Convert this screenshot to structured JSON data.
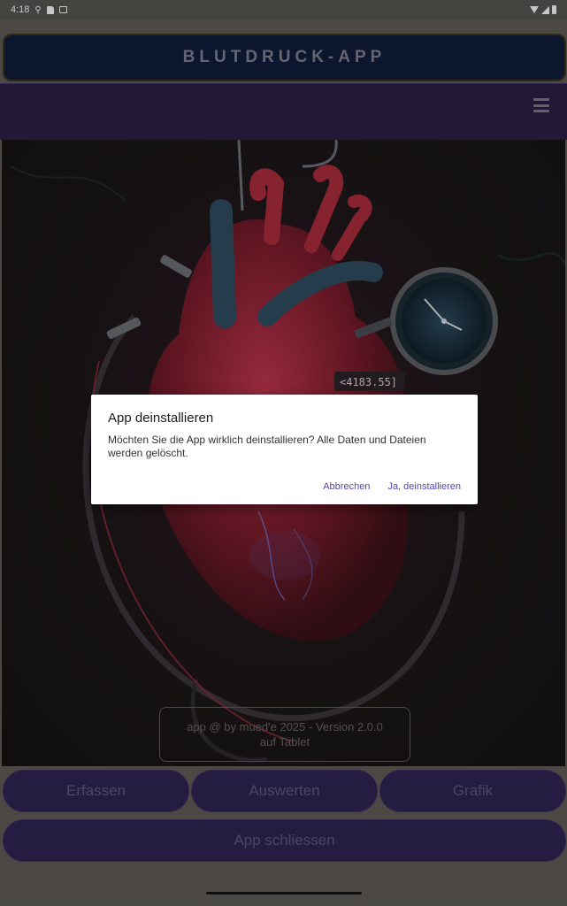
{
  "status_bar": {
    "time": "4:18"
  },
  "header": {
    "title": "BLUTDRUCK-APP"
  },
  "hero": {
    "monitor_reading": "<4183.55]",
    "copyright_line1": "app @ by mued'e 2025 - Version 2.0.0",
    "copyright_line2": "auf Tablet"
  },
  "dialog": {
    "title": "App deinstallieren",
    "message": "Möchten Sie die App wirklich deinstallieren? Alle Daten und Dateien werden gelöscht.",
    "cancel_label": "Abbrechen",
    "confirm_label": "Ja, deinstallieren"
  },
  "buttons": {
    "erfassen": "Erfassen",
    "auswerten": "Auswerten",
    "grafik": "Grafik",
    "close_app": "App schliessen"
  },
  "icons": {
    "menu": "hamburger-menu-icon",
    "status": [
      "usb-icon",
      "sd-card-icon",
      "message-icon",
      "wifi-icon",
      "signal-icon",
      "battery-icon"
    ]
  },
  "colors": {
    "header_bg": "#0f1c3a",
    "nav_bg": "#2a1f45",
    "button_bg": "#2e2350",
    "dialog_accent": "#5a3fb8"
  }
}
